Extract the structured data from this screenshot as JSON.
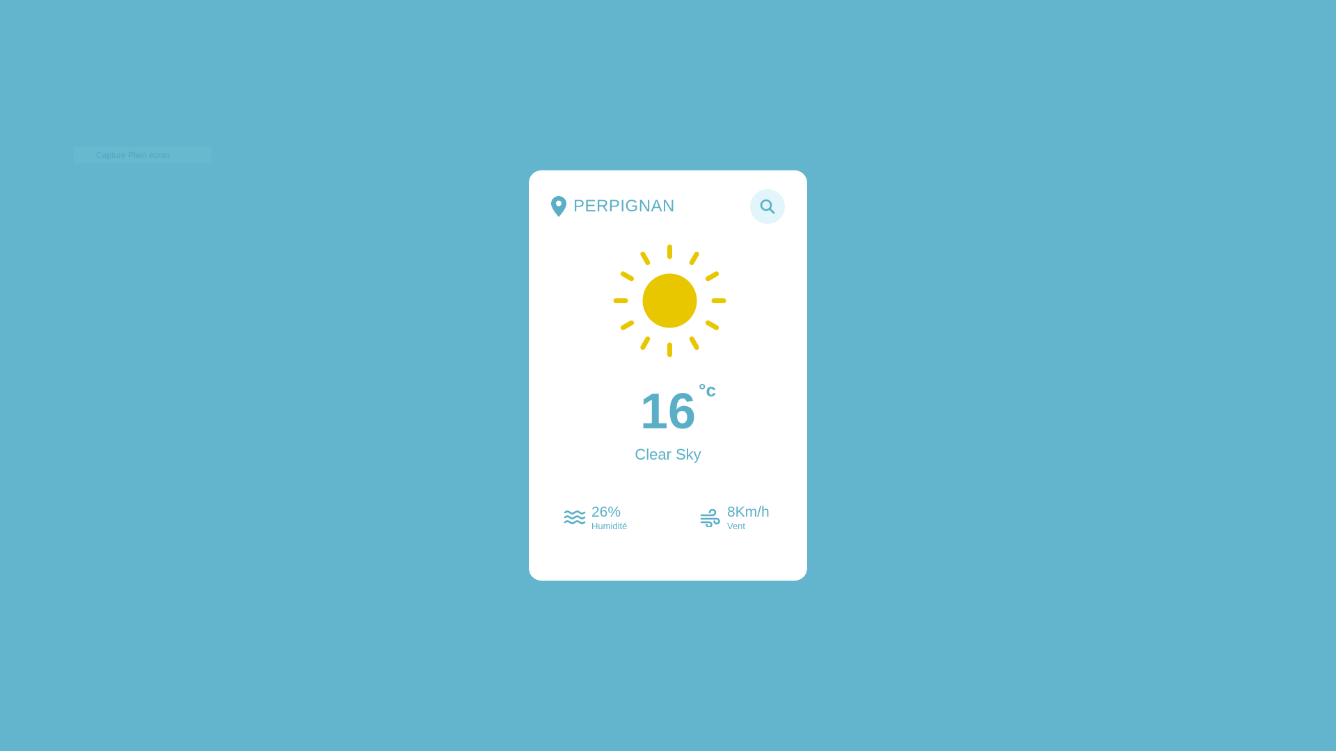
{
  "overlay": {
    "label": "Capture Plein écran"
  },
  "card": {
    "city": "PERPIGNAN",
    "weather_icon": "sun-icon",
    "temperature": "16",
    "unit": "°c",
    "condition": "Clear Sky",
    "humidity": {
      "value": "26%",
      "label": "Humidité",
      "icon": "waves-icon"
    },
    "wind": {
      "value": "8Km/h",
      "label": "Vent",
      "icon": "wind-icon"
    }
  },
  "colors": {
    "background": "#62b5cc",
    "card": "#ffffff",
    "accent": "#5aafc6",
    "search_bg": "#e2f5fb",
    "sun": "#e8c600"
  }
}
